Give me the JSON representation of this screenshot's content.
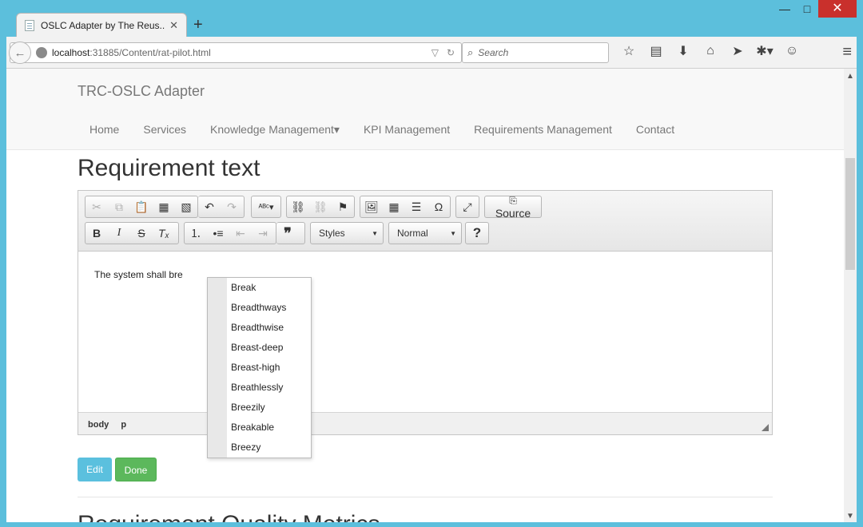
{
  "browser": {
    "tab_title": "OSLC Adapter by The Reus...",
    "tab_close": "✕",
    "new_tab": "+",
    "window_controls": {
      "minimize": "—",
      "maximize": "□",
      "close": "✕"
    },
    "url": {
      "host": "localhost",
      "path": ":31885/Content/rat-pilot.html"
    },
    "search_placeholder": "Search",
    "icons": [
      "star-icon",
      "reader-icon",
      "download-icon",
      "home-icon",
      "send-icon",
      "extension-icon",
      "emoji-icon",
      "hamburger-menu-icon"
    ]
  },
  "site": {
    "brand": "TRC-OSLC Adapter",
    "nav": [
      "Home",
      "Services",
      "Knowledge Management▾",
      "KPI Management",
      "Requirements Management",
      "Contact"
    ]
  },
  "page": {
    "title": "Requirement text",
    "next_section_title": "Requirement Quality Metrics"
  },
  "editor": {
    "source_label": "Source",
    "styles_combo": "Styles",
    "format_combo": "Normal",
    "help_button": "?",
    "content_text": "The system shall bre",
    "path": [
      "body",
      "p"
    ],
    "autocomplete": [
      "Break",
      "Breadthways",
      "Breadthwise",
      "Breast-deep",
      "Breast-high",
      "Breathlessly",
      "Breezily",
      "Breakable",
      "Breezy"
    ]
  },
  "buttons": {
    "edit": "Edit",
    "done": "Done"
  },
  "colors": {
    "edit": "#5bc0de",
    "done": "#5cb85c",
    "window_frame": "#5cbfdc"
  }
}
